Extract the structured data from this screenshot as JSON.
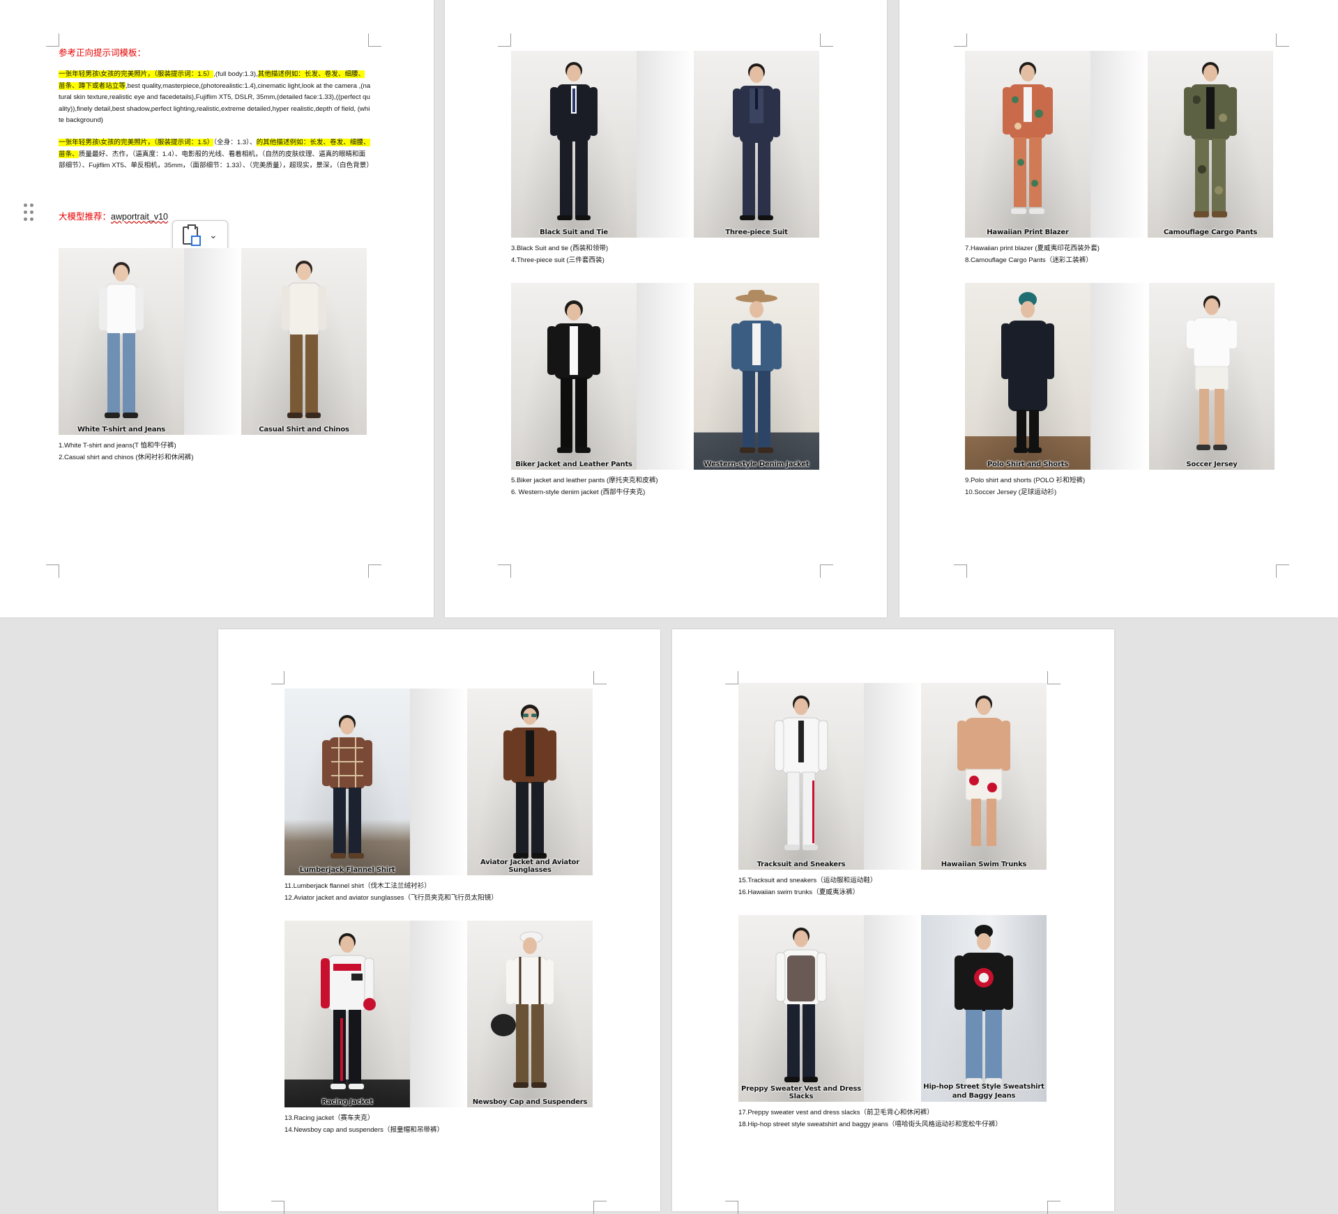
{
  "page1": {
    "heading": "参考正向提示词模板：",
    "para1_hl": "一张年轻男孩\\女孩的完美照片，（服装提示词：1.5）",
    "para1_mid": ",(full body:1.3),",
    "para1_hl2": "其他描述例如：长发、卷发、细腰、苗条、蹲下或者站立等",
    "para1_rest": ",best quality,masterpiece,(photorealistic:1.4),cinematic light,look at the camera ,(natural skin texture,realistic eye and facedetails),Fujiflim XT5, DSLR, 35mm,(detailed face:1.33),((perfect quality)),finely detail,best shadow,perfect lighting,realistic,extreme detailed,hyper realistic,depth of field, (white background)",
    "para2_hl": "一张年轻男孩\\女孩的完美照片，（服装提示词：1.5）",
    "para2_mid": "（全身：1.3）、",
    "para2_hl2": "的其他描述例如：长发、卷发、细腰、苗条、",
    "para2_rest": "质量最好、杰作，（逼真度：1.4）、电影般的光线、看着相机，（自然的皮肤纹理、逼真的眼睛和面部细节）、Fujiflim XT5、单反相机，35mm，（面部细节：1.33）、（完美质量），超现实，景深，（白色背景）",
    "model_label": "大模型推荐：",
    "model_name": "awportrait_v10",
    "photos": [
      {
        "caption": "White T-shirt and Jeans"
      },
      {
        "caption": "Casual Shirt and Chinos"
      }
    ],
    "descs": [
      "1.White T-shirt and jeans(T 恤和牛仔裤)",
      "2.Casual shirt and chinos (休闲衬衫和休闲裤)"
    ]
  },
  "page2": {
    "photos": [
      {
        "caption": "Black Suit and Tie"
      },
      {
        "caption": "Three-piece Suit"
      },
      {
        "caption": "Biker Jacket and Leather Pants"
      },
      {
        "caption": "Western-style Denim Jacket"
      }
    ],
    "descs": [
      "3.Black Suit and tie (西装和领带)",
      "4.Three-piece suit (三件套西装)",
      "5.Biker jacket and leather pants (摩托夹克和皮裤)",
      "6. Western-style denim jacket (西部牛仔夹克)"
    ]
  },
  "page3": {
    "photos": [
      {
        "caption": "Hawaiian Print Blazer"
      },
      {
        "caption": "Camouflage Cargo Pants"
      },
      {
        "caption": "Polo Shirt and Shorts"
      },
      {
        "caption": "Soccer Jersey"
      }
    ],
    "descs": [
      "7.Hawaiian print blazer (夏威夷印花西装外套)",
      "8.Camouflage Cargo Pants（迷彩工装裤）",
      "9.Polo shirt and shorts (POLO 衫和短裤)",
      "10.Soccer Jersey (足球运动衫)"
    ]
  },
  "page4": {
    "photos": [
      {
        "caption": "Lumberjack Flannel Shirt"
      },
      {
        "caption": "Aviator Jacket and Aviator Sunglasses"
      },
      {
        "caption": "Racing Jacket"
      },
      {
        "caption": "Newsboy Cap and Suspenders"
      }
    ],
    "descs": [
      "11.Lumberjack flannel shirt（伐木工法兰绒衬衫）",
      "12.Aviator jacket and aviator sunglasses（飞行员夹克和飞行员太阳镜）",
      "13.Racing jacket（赛车夹克）",
      "14.Newsboy cap and suspenders（报童帽和吊带裤）"
    ]
  },
  "page5": {
    "photos": [
      {
        "caption": "Tracksuit and Sneakers"
      },
      {
        "caption": "Hawaiian Swim Trunks"
      },
      {
        "caption": "Preppy Sweater Vest and Dress Slacks"
      },
      {
        "caption": "Hip-hop Street Style Sweatshirt and Baggy Jeans"
      }
    ],
    "descs": [
      "15.Tracksuit and sneakers（运动服和运动鞋）",
      "16.Hawaiian swim trunks（夏威夷泳裤）",
      "17.Preppy sweater vest and dress slacks（前卫毛背心和休闲裤）",
      "18.Hip-hop street style sweatshirt and baggy jeans（嘻哈街头风格运动衫和宽松牛仔裤）"
    ]
  },
  "colors": {
    "heading_red": "#e60000",
    "highlight": "#ffff00",
    "page_bg": "#ffffff",
    "desk_bg": "#e3e3e3",
    "accent_blue": "#2a73d9"
  }
}
